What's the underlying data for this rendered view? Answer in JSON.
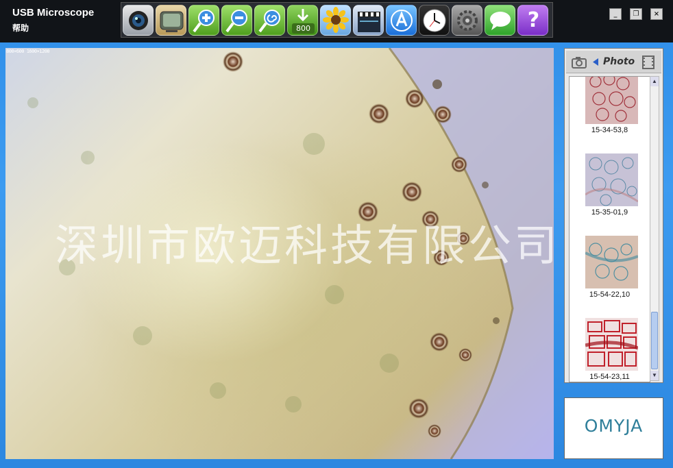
{
  "app": {
    "title": "USB Microscope",
    "help_menu": "帮助"
  },
  "toolbar": {
    "buttons": [
      {
        "name": "camera-capture",
        "icon": "camera-lens-icon"
      },
      {
        "name": "video-player",
        "icon": "tv-icon"
      },
      {
        "name": "zoom-in",
        "icon": "zoom-in-icon"
      },
      {
        "name": "zoom-out",
        "icon": "zoom-out-icon"
      },
      {
        "name": "zoom-reset",
        "icon": "zoom-spiral-icon"
      },
      {
        "name": "resolution",
        "icon": "download-arrow-icon",
        "label": "800"
      },
      {
        "name": "photos",
        "icon": "sunflower-icon"
      },
      {
        "name": "video-record",
        "icon": "clapperboard-icon"
      },
      {
        "name": "app-store",
        "icon": "app-store-icon"
      },
      {
        "name": "timer",
        "icon": "clock-icon"
      },
      {
        "name": "settings",
        "icon": "gear-icon"
      },
      {
        "name": "messages",
        "icon": "speech-bubble-icon"
      },
      {
        "name": "help",
        "icon": "question-icon",
        "label": "?"
      }
    ]
  },
  "window_controls": {
    "minimize": "_",
    "restore": "❐",
    "close": "×"
  },
  "viewer": {
    "info_text": "800×600  1600×1200",
    "watermark": "深圳市欧迈科技有限公司"
  },
  "side_panel": {
    "mode_label": "Photo",
    "thumbnails": [
      {
        "caption": "15-34-53,8"
      },
      {
        "caption": "15-35-01,9"
      },
      {
        "caption": "15-54-22,10"
      },
      {
        "caption": "15-54-23,11"
      }
    ]
  },
  "logo": {
    "text": "OMYJA"
  },
  "colors": {
    "background": "#2f8ee8",
    "titlebar": "#111418",
    "logo_text": "#2f7f9a"
  }
}
